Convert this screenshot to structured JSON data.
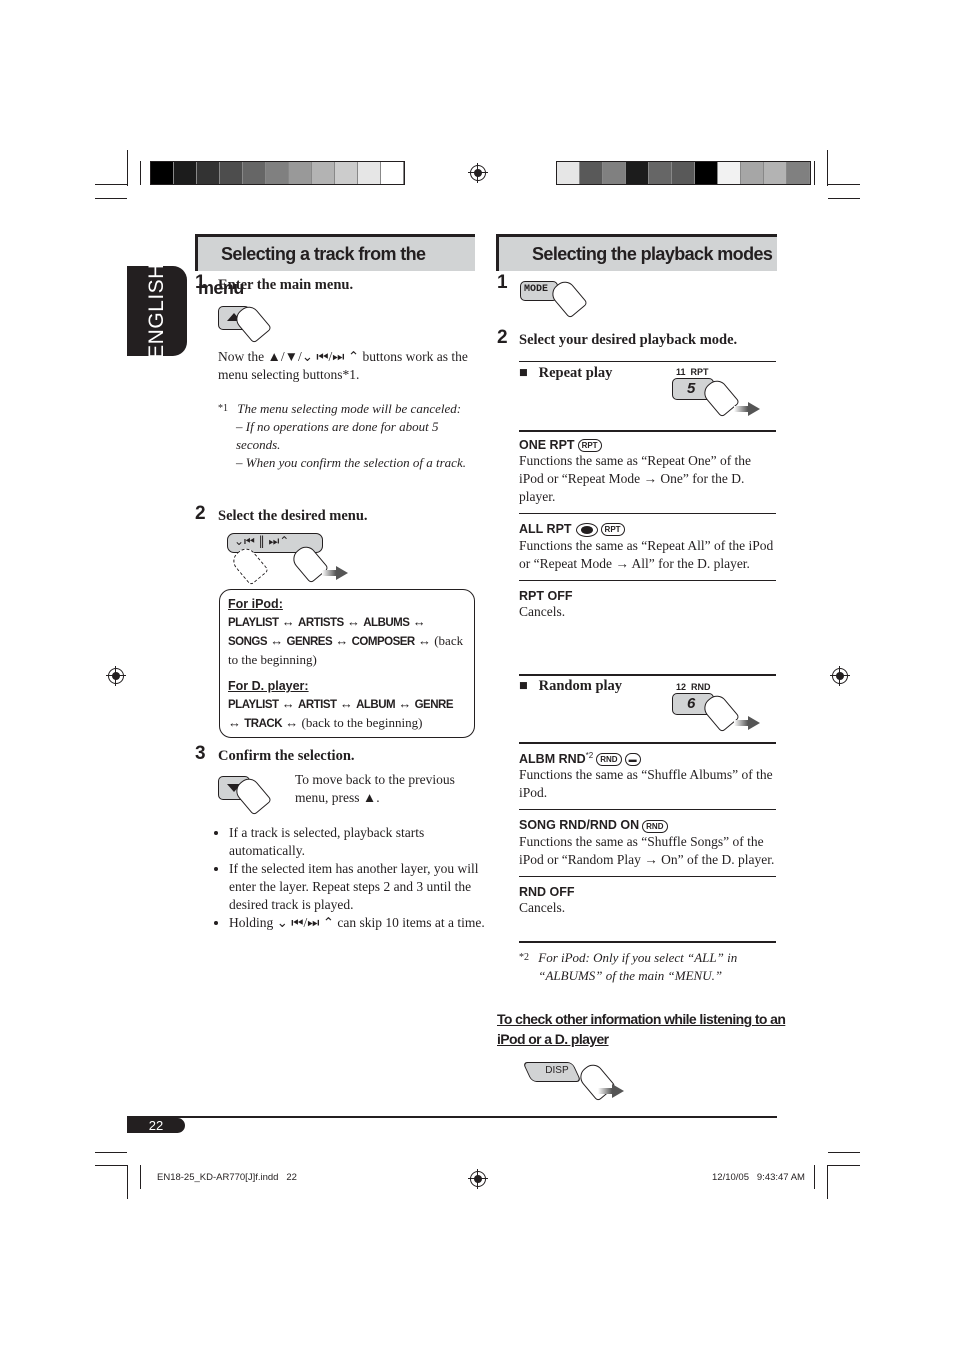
{
  "calibration": {
    "left_swatches": [
      "#000000",
      "#1c1c1c",
      "#333333",
      "#4d4d4d",
      "#666666",
      "#808080",
      "#999999",
      "#b3b3b3",
      "#cccccc",
      "#e6e6e6",
      "#ffffff"
    ],
    "right_swatches": [
      "#e6e6e6",
      "#595959",
      "#808080",
      "#1c1c1c",
      "#666666",
      "#595959",
      "#000000",
      "#f2f2f2",
      "#a6a6a6",
      "#b3b3b3",
      "#808080"
    ]
  },
  "language_tab": "ENGLISH",
  "left": {
    "title": "Selecting a track from the menu",
    "step1": {
      "num": "1",
      "title": "Enter the main menu.",
      "icon": "up-button-icon",
      "text": "Now the ▲/▼/⌄ ⏮/⏭ ⌃ buttons work as the menu selecting buttons*1."
    },
    "footnote1": {
      "mark": "*1",
      "title": "The menu selecting mode will be canceled:",
      "items": [
        "– If no operations are done for about 5 seconds.",
        "– When you confirm the selection of a track."
      ]
    },
    "step2": {
      "num": "2",
      "title": "Select the desired menu.",
      "icon": "skip-buttons-icon"
    },
    "menu_box": {
      "ipod_heading": "For iPod:",
      "ipod_sequence": [
        "PLAYLIST",
        "ARTISTS",
        "ALBUMS",
        "SONGS",
        "GENRES",
        "COMPOSER"
      ],
      "ipod_tail": "(back to the beginning)",
      "dplayer_heading": "For D. player:",
      "dplayer_sequence": [
        "PLAYLIST",
        "ARTIST",
        "ALBUM",
        "GENRE",
        "TRACK"
      ],
      "dplayer_tail": "(back to the beginning)",
      "separator": "↔"
    },
    "step3": {
      "num": "3",
      "title": "Confirm the selection.",
      "icon": "down-button-icon",
      "side_text": "To move back to the previous menu, press ▲."
    },
    "bullets": [
      "If a track is selected, playback starts automatically.",
      "If the selected item has another layer, you will enter the layer. Repeat steps 2 and 3 until the desired track is played.",
      "Holding ⌄ ⏮/⏭ ⌃ can skip 10 items at a time."
    ]
  },
  "right": {
    "title": "Selecting the playback modes",
    "step1": {
      "num": "1",
      "button": "MODE"
    },
    "step2": {
      "num": "2",
      "title": "Select your desired playback mode."
    },
    "repeat": {
      "heading": "Repeat play",
      "button_caption": "11  RPT",
      "button_digit": "5",
      "modes": [
        {
          "label": "ONE RPT",
          "indicators": [
            "RPT"
          ],
          "text": "Functions the same as “Repeat One” of the iPod or “Repeat Mode → One” for the D. player."
        },
        {
          "label": "ALL RPT",
          "indicators": [
            "disc",
            "RPT"
          ],
          "text": "Functions the same as “Repeat All” of the iPod or “Repeat Mode → All” for the D. player."
        },
        {
          "label": "RPT OFF",
          "indicators": [],
          "text": "Cancels."
        }
      ]
    },
    "random": {
      "heading": "Random play",
      "button_caption": "12  RND",
      "button_digit": "6",
      "modes": [
        {
          "label": "ALBM RND",
          "sup": "*2",
          "indicators": [
            "RND",
            "folder"
          ],
          "text": "Functions the same as “Shuffle Albums” of the iPod."
        },
        {
          "label": "SONG RND/RND ON",
          "indicators": [
            "RND"
          ],
          "text": "Functions the same as “Shuffle Songs” of the iPod or “Random Play → On” of the D. player."
        },
        {
          "label": "RND OFF",
          "indicators": [],
          "text": "Cancels."
        }
      ]
    },
    "footnote2": {
      "mark": "*2",
      "text": "For iPod: Only if you select “ALL” in “ALBUMS” of the main “MENU.”"
    },
    "info_heading": "To check other information while listening to an iPod or a D. player",
    "disp_button": "DISP"
  },
  "page_number": "22",
  "footer": {
    "file": "EN18-25_KD-AR770[J]f.indd   22",
    "timestamp": "12/10/05   9:43:47 AM"
  }
}
